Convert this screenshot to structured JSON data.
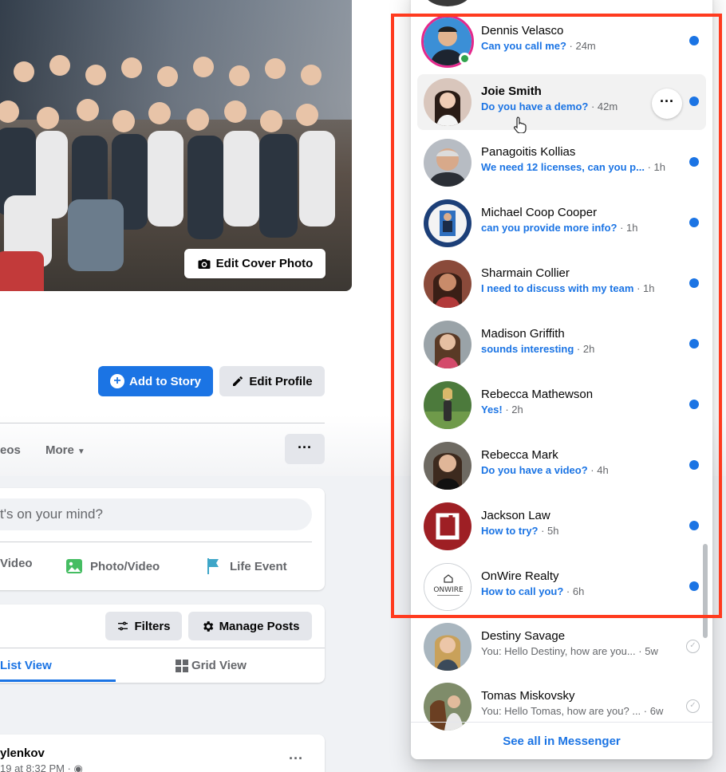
{
  "profile": {
    "edit_cover_label": "Edit Cover Photo",
    "add_story_label": "Add to Story",
    "edit_profile_label": "Edit Profile",
    "tabs": {
      "videos": "eos",
      "more": "More"
    },
    "composer": {
      "placeholder": "t's on your mind?",
      "live_video": "Video",
      "photo_video": "Photo/Video",
      "life_event": "Life Event"
    },
    "posts": {
      "filters": "Filters",
      "manage_posts": "Manage Posts",
      "list_view": "List View",
      "grid_view": "Grid View"
    },
    "post": {
      "author": "ylenkov",
      "meta": "19 at 8:32 PM ·"
    }
  },
  "messenger": {
    "conversations": [
      {
        "name": "Dennis Velasco",
        "message": "Can you call me?",
        "time": " · 24m",
        "unread": true,
        "online": true,
        "story": true
      },
      {
        "name": "Joie Smith",
        "message": "Do you have a demo?",
        "time": " · 42m",
        "unread": true
      },
      {
        "name": "Panagoitis Kollias",
        "message": "We need 12 licenses, can you p...",
        "time": " · 1h",
        "unread": true
      },
      {
        "name": "Michael Coop Cooper",
        "message": "can you provide more info?",
        "time": " · 1h",
        "unread": true
      },
      {
        "name": "Sharmain Collier",
        "message": "I need to discuss with my team",
        "time": " · 1h",
        "unread": true
      },
      {
        "name": "Madison Griffith",
        "message": "sounds interesting",
        "time": " · 2h",
        "unread": true
      },
      {
        "name": "Rebecca Mathewson",
        "message": "Yes!",
        "time": " · 2h",
        "unread": true
      },
      {
        "name": "Rebecca Mark",
        "message": "Do you have a video?",
        "time": " · 4h",
        "unread": true
      },
      {
        "name": "Jackson Law",
        "message": "How to try?",
        "time": " · 5h",
        "unread": true
      },
      {
        "name": "OnWire Realty",
        "message": "How to call you?",
        "time": " · 6h",
        "unread": true
      },
      {
        "name": "Destiny Savage",
        "message": "You: Hello Destiny, how are you...",
        "time": " · 5w",
        "unread": false
      },
      {
        "name": "Tomas Miskovsky",
        "message": "You: Hello Tomas, how are you? ...",
        "time": " · 6w",
        "unread": false
      }
    ],
    "see_all": "See all in Messenger",
    "onwire_logo_text": "ONWIRE"
  },
  "colors": {
    "accent": "#1b74e4",
    "highlight": "#ff3b1f",
    "online": "#31a24c"
  }
}
